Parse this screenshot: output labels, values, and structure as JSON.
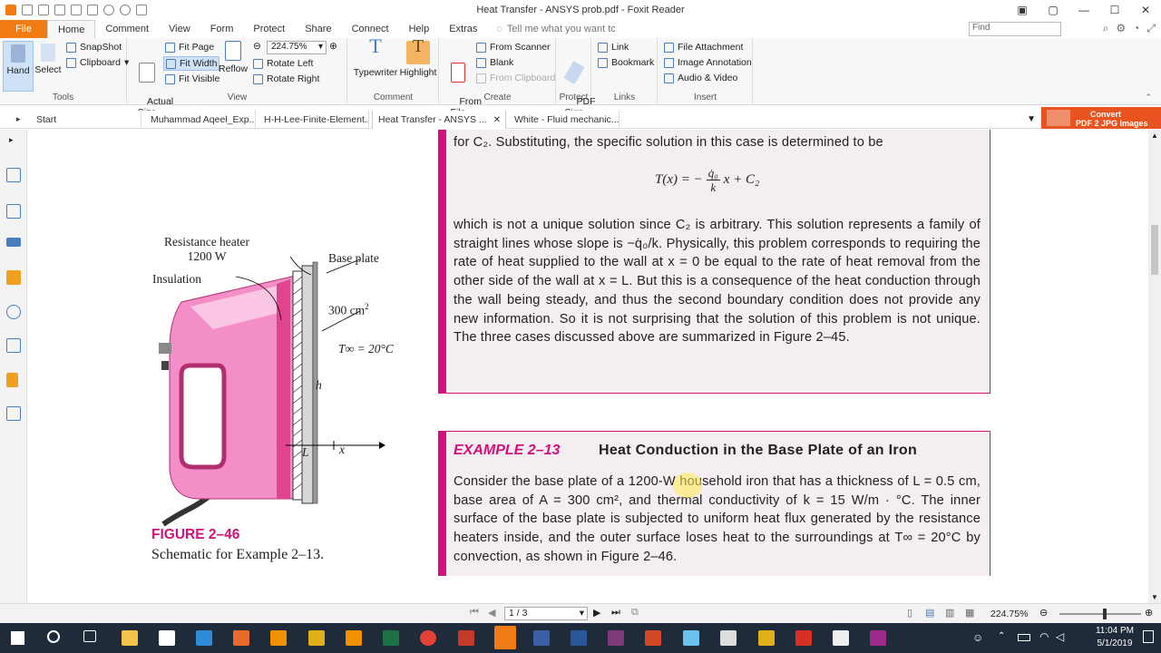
{
  "window": {
    "title": "Heat Transfer - ANSYS prob.pdf - Foxit Reader"
  },
  "menu": {
    "file": "File",
    "items": [
      "Home",
      "Comment",
      "View",
      "Form",
      "Protect",
      "Share",
      "Connect",
      "Help",
      "Extras"
    ],
    "tellme": "Tell me what you want tc",
    "find_placeholder": "Find"
  },
  "ribbon": {
    "tools": {
      "hand": "Hand",
      "select": "Select",
      "snapshot": "SnapShot",
      "clipboard": "Clipboard",
      "label": "Tools"
    },
    "view": {
      "actual_size": "Actual\nSize",
      "fit_page": "Fit Page",
      "fit_width": "Fit Width",
      "fit_visible": "Fit Visible",
      "reflow": "Reflow",
      "zoom": "224.75%",
      "rotate_left": "Rotate Left",
      "rotate_right": "Rotate Right",
      "label": "View"
    },
    "comment": {
      "typewriter": "Typewriter",
      "highlight": "Highlight",
      "label": "Comment"
    },
    "create": {
      "from_file": "From\nFile",
      "from_scanner": "From Scanner",
      "blank": "Blank",
      "from_clipboard": "From Clipboard",
      "label": "Create"
    },
    "protect": {
      "pdf_sign": "PDF\nSign",
      "label": "Protect"
    },
    "links": {
      "link": "Link",
      "bookmark": "Bookmark",
      "label": "Links"
    },
    "insert": {
      "file_attachment": "File Attachment",
      "image_annotation": "Image Annotation",
      "audio_video": "Audio & Video",
      "label": "Insert"
    }
  },
  "tabs": [
    "Start",
    "Muhammad Aqeel_Exp...",
    "H-H-Lee-Finite-Element...",
    "Heat Transfer - ANSYS ...",
    "White - Fluid mechanic..."
  ],
  "convert_banner": {
    "line1": "Convert",
    "line2": "PDF 2 JPG Images"
  },
  "figure": {
    "resistance_heater": "Resistance heater",
    "heater_power": "1200 W",
    "insulation": "Insulation",
    "base_plate": "Base plate",
    "area": "300 cm",
    "area_exp": "2",
    "temp": "T∞ = 20°C",
    "h": "h",
    "L": "L",
    "x": "x",
    "caption_title": "FIGURE 2–46",
    "caption_text": "Schematic for Example 2–13."
  },
  "box1": {
    "line_top": "for C₂. Substituting, the specific solution in this case is determined to be",
    "equation_lhs": "T(x) = −",
    "equation_num": "q̇₀",
    "equation_den": "k",
    "equation_rhs": "x + C₂",
    "paragraph": "which is not a unique solution since C₂ is arbitrary. This solution represents a family of straight lines whose slope is −q̇₀/k. Physically, this problem corresponds to requiring the rate of heat supplied to the wall at x = 0 be equal to the rate of heat removal from the other side of the wall at x = L. But this is a consequence of the heat conduction through the wall being steady, and thus the second boundary condition does not provide any new information. So it is not surprising that the solution of this problem is not unique. The three cases discussed above are summarized in Figure 2–45."
  },
  "example": {
    "number": "EXAMPLE 2–13",
    "title": "Heat Conduction in the Base Plate of an Iron",
    "paragraph": "Consider the base plate of a 1200-W household iron that has a thickness of L = 0.5 cm, base area of A = 300 cm², and thermal conductivity of k = 15 W/m · °C. The inner surface of the base plate is subjected to uniform heat flux generated by the resistance heaters inside, and the outer surface loses heat to the surroundings at T∞ = 20°C by convection, as shown in Figure 2–46."
  },
  "status": {
    "page": "1 / 3",
    "zoom": "224.75%"
  },
  "clock": {
    "time": "11:04 PM",
    "date": "5/1/2019"
  },
  "colors": {
    "accent": "#f07c13",
    "magenta": "#d2127a",
    "box_bg": "#f4edf2",
    "pink_iron": "#ef7fbf"
  }
}
